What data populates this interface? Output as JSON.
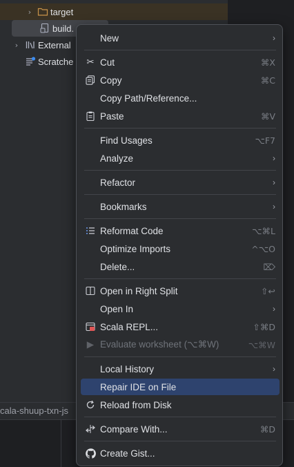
{
  "tree": {
    "target": "target",
    "build": "build.",
    "external": "External",
    "scratches": "Scratche"
  },
  "status_bar": {
    "path": "cala-shuup-txn-js"
  },
  "menu": {
    "new": {
      "label": "New"
    },
    "cut": {
      "label": "Cut",
      "shortcut": "⌘X"
    },
    "copy": {
      "label": "Copy",
      "shortcut": "⌘C"
    },
    "copy_path": {
      "label": "Copy Path/Reference..."
    },
    "paste": {
      "label": "Paste",
      "shortcut": "⌘V"
    },
    "find_usages": {
      "label": "Find Usages",
      "shortcut": "⌥F7"
    },
    "analyze": {
      "label": "Analyze"
    },
    "refactor": {
      "label": "Refactor"
    },
    "bookmarks": {
      "label": "Bookmarks"
    },
    "reformat": {
      "label": "Reformat Code",
      "shortcut": "⌥⌘L"
    },
    "optimize": {
      "label": "Optimize Imports",
      "shortcut": "^⌥O"
    },
    "delete": {
      "label": "Delete...",
      "shortcut": "⌦"
    },
    "open_split": {
      "label": "Open in Right Split",
      "shortcut": "⇧↩"
    },
    "open_in": {
      "label": "Open In"
    },
    "scala_repl": {
      "label": "Scala REPL...",
      "shortcut": "⇧⌘D"
    },
    "evaluate": {
      "label": "Evaluate worksheet (⌥⌘W)",
      "shortcut": "⌥⌘W"
    },
    "local_history": {
      "label": "Local History"
    },
    "repair": {
      "label": "Repair IDE on File"
    },
    "reload": {
      "label": "Reload from Disk"
    },
    "compare": {
      "label": "Compare With...",
      "shortcut": "⌘D"
    },
    "gist": {
      "label": "Create Gist..."
    }
  },
  "colors": {
    "menu_bg": "#2b2d30",
    "selection": "#2e436e",
    "target_folder_highlight": "#3a3224"
  }
}
